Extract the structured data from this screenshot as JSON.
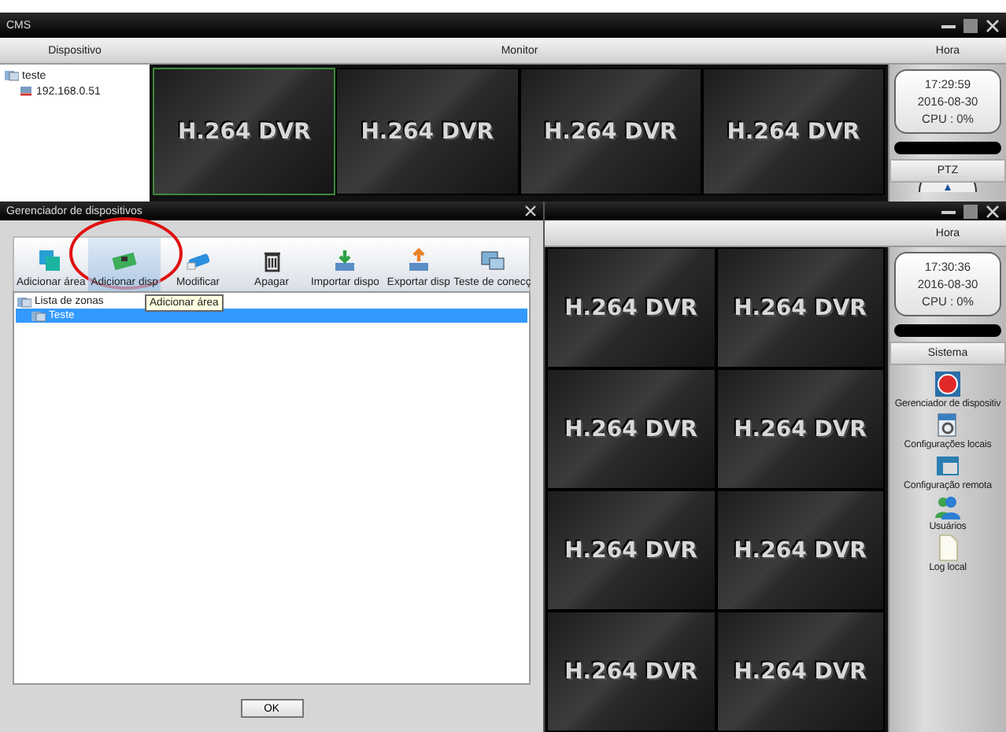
{
  "background_window": {
    "title": "CMS",
    "headers": [
      "Dispositivo",
      "Monitor",
      "Hora"
    ],
    "device_tree": [
      {
        "label": "teste",
        "children": [
          {
            "label": "192.168.0.51"
          }
        ]
      }
    ],
    "tiles": [
      {
        "label": "H.264 DVR",
        "selected": true
      },
      {
        "label": "H.264 DVR",
        "selected": false
      },
      {
        "label": "H.264 DVR",
        "selected": false
      },
      {
        "label": "H.264 DVR",
        "selected": false
      }
    ],
    "clock": {
      "time": "17:29:59",
      "date": "2016-08-30",
      "cpu": "CPU : 0%"
    },
    "ptz_header": "PTZ"
  },
  "main_window": {
    "header": "Hora",
    "tiles": [
      {
        "label": "H.264 DVR",
        "selected": false
      },
      {
        "label": "H.264 DVR",
        "selected": false
      },
      {
        "label": "H.264 DVR",
        "selected": false
      },
      {
        "label": "H.264 DVR",
        "selected": false
      },
      {
        "label": "H.264 DVR",
        "selected": false
      },
      {
        "label": "H.264 DVR",
        "selected": false
      },
      {
        "label": "H.264 DVR",
        "selected": false
      },
      {
        "label": "H.264 DVR",
        "selected": false
      }
    ],
    "clock": {
      "time": "17:30:36",
      "date": "2016-08-30",
      "cpu": "CPU : 0%"
    },
    "system_header": "Sistema",
    "system_items": [
      {
        "label": "Gerenciador de dispositiv",
        "kind": "record"
      },
      {
        "label": "Configurações locais",
        "kind": "local"
      },
      {
        "label": "Configuração remota",
        "kind": "remote"
      },
      {
        "label": "Usuários",
        "kind": "users"
      },
      {
        "label": "Log local",
        "kind": "log"
      }
    ]
  },
  "dialog": {
    "title": "Gerenciador de dispositivos",
    "toolbar": [
      {
        "label": "Adicionar área",
        "kind": "area",
        "selected": false
      },
      {
        "label": "Adicionar disp",
        "kind": "device",
        "selected": true
      },
      {
        "label": "Modificar",
        "kind": "modify",
        "selected": false
      },
      {
        "label": "Apagar",
        "kind": "delete",
        "selected": false
      },
      {
        "label": "Importar dispo",
        "kind": "import",
        "selected": false
      },
      {
        "label": "Exportar disp",
        "kind": "export",
        "selected": false
      },
      {
        "label": "Teste de conecç",
        "kind": "test",
        "selected": false
      }
    ],
    "tooltip": "Adicionar área",
    "tree": [
      {
        "label": "Lista de zonas",
        "selected": false,
        "children": [
          {
            "label": "Teste",
            "selected": true
          }
        ]
      }
    ],
    "ok_button": "OK"
  }
}
